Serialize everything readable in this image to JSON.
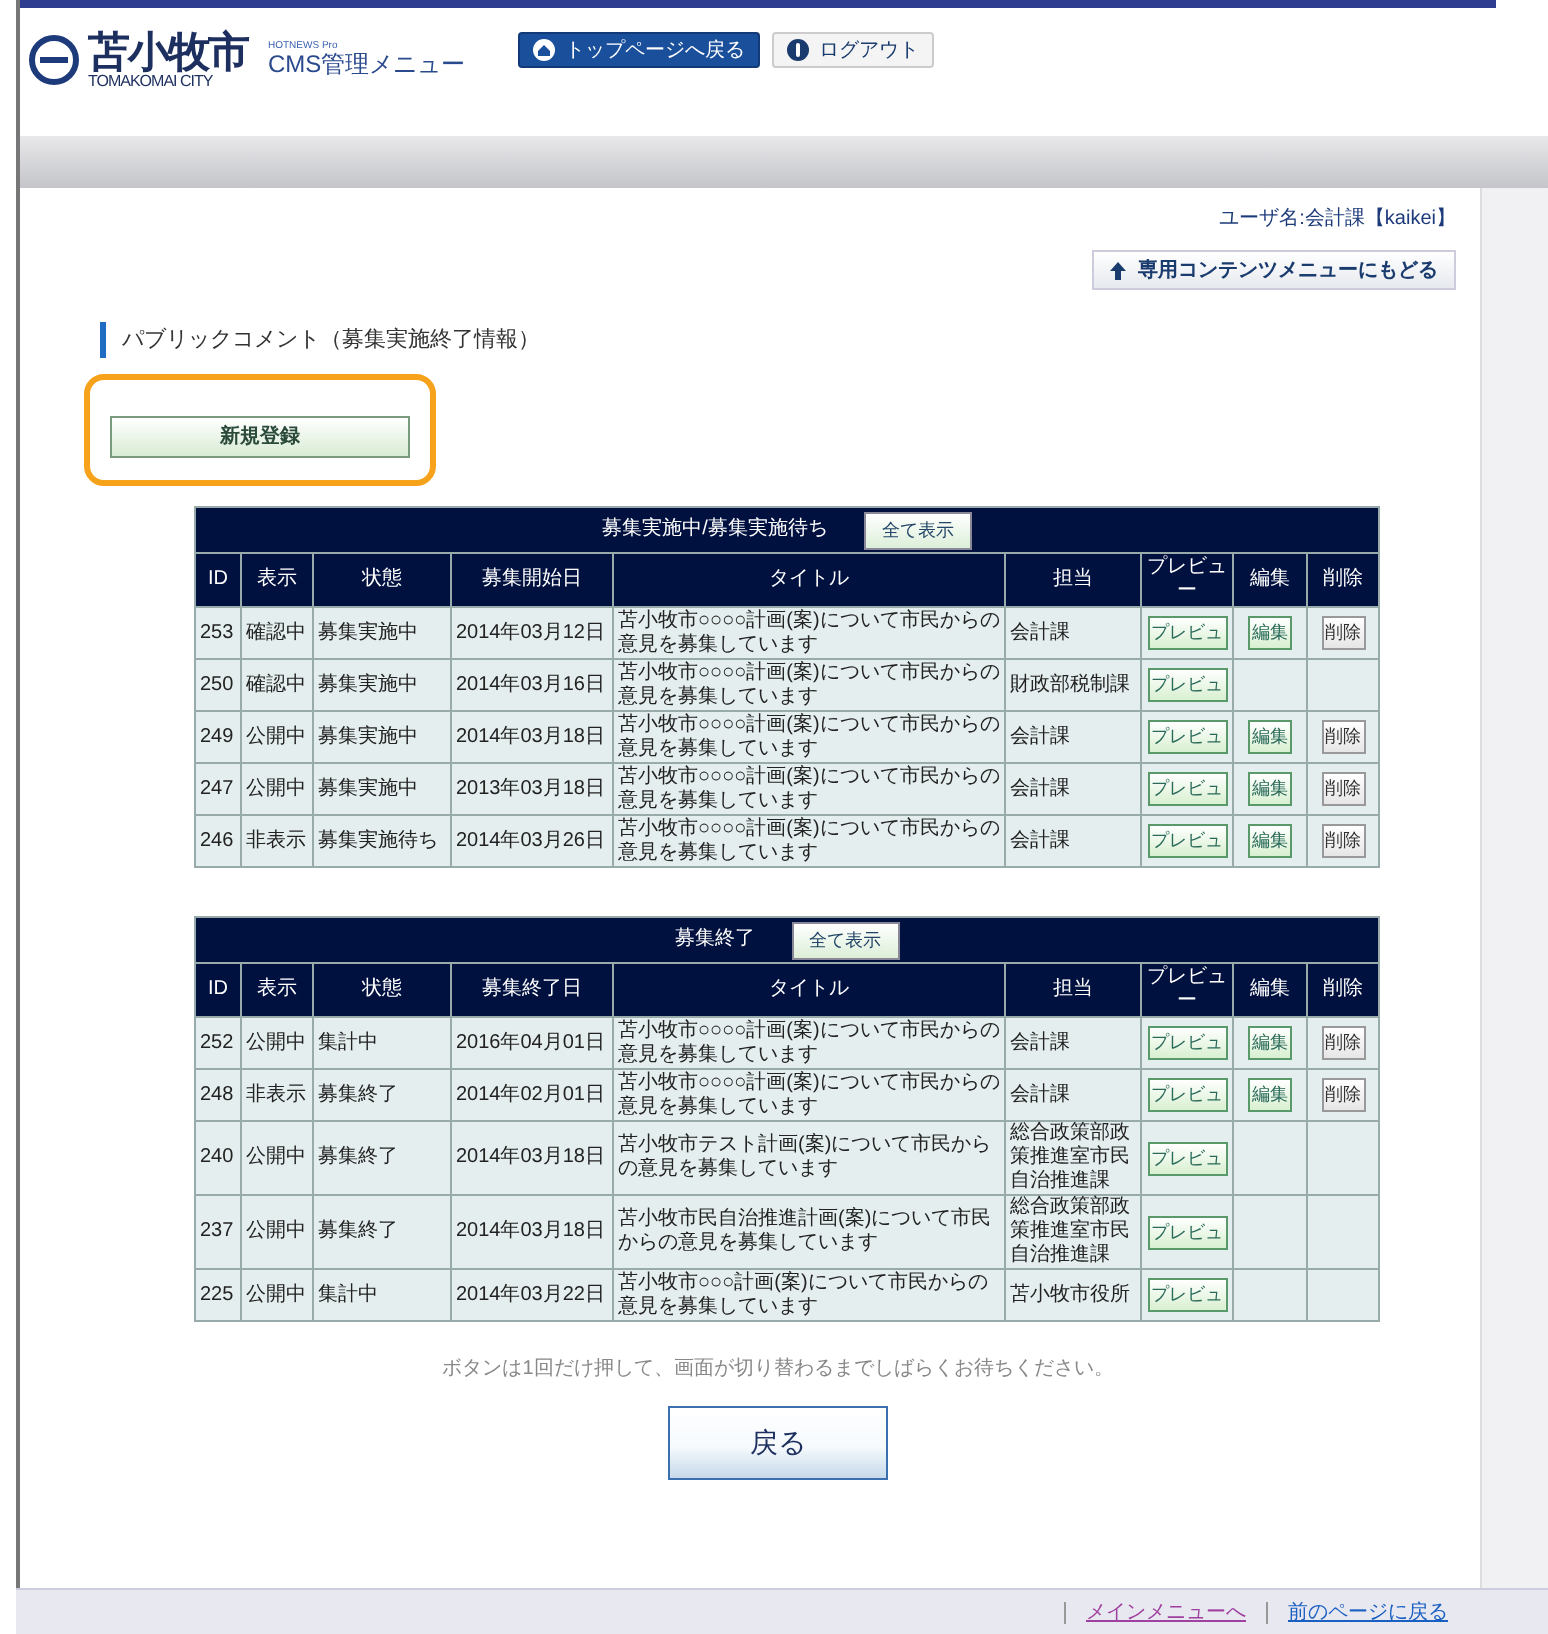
{
  "header": {
    "logo_text": "苫小牧市",
    "logo_sub": "TOMAKOMAI CITY",
    "product": "HOTNEWS Pro",
    "app_title": "CMS管理メニュー",
    "buttons": [
      {
        "label": "トップページへ戻る",
        "kind": "primary"
      },
      {
        "label": "ログアウト",
        "kind": "plain"
      }
    ]
  },
  "user": "ユーザ名:会計課【kaikei】",
  "content_menu_button": "専用コンテンツメニューにもどる",
  "heading": "パブリックコメント（募集実施終了情報）",
  "new_button": "新規登録",
  "tables": [
    {
      "title": "募集実施中/募集実施待ち",
      "show_all": "全て表示",
      "columns": [
        "ID",
        "表示",
        "状態",
        "募集開始日",
        "タイトル",
        "担当",
        "プレビュー",
        "編集",
        "削除"
      ],
      "rows": [
        {
          "id": "253",
          "display": "確認中",
          "status": "募集実施中",
          "date": "2014年03月12日",
          "title": "苫小牧市○○○○計画(案)について市民からの意見を募集しています",
          "owner": "会計課",
          "preview": "プレビュ",
          "edit": "編集",
          "delete": "削除"
        },
        {
          "id": "250",
          "display": "確認中",
          "status": "募集実施中",
          "date": "2014年03月16日",
          "title": "苫小牧市○○○○計画(案)について市民からの意見を募集しています",
          "owner": "財政部税制課",
          "preview": "プレビュ"
        },
        {
          "id": "249",
          "display": "公開中",
          "status": "募集実施中",
          "date": "2014年03月18日",
          "title": "苫小牧市○○○○計画(案)について市民からの意見を募集しています",
          "owner": "会計課",
          "preview": "プレビュ",
          "edit": "編集",
          "delete": "削除"
        },
        {
          "id": "247",
          "display": "公開中",
          "status": "募集実施中",
          "date": "2013年03月18日",
          "title": "苫小牧市○○○○計画(案)について市民からの意見を募集しています",
          "owner": "会計課",
          "preview": "プレビュ",
          "edit": "編集",
          "delete": "削除"
        },
        {
          "id": "246",
          "display": "非表示",
          "status": "募集実施待ち",
          "date": "2014年03月26日",
          "title": "苫小牧市○○○○計画(案)について市民からの意見を募集しています",
          "owner": "会計課",
          "preview": "プレビュ",
          "edit": "編集",
          "delete": "削除"
        }
      ]
    },
    {
      "title": "募集終了",
      "show_all": "全て表示",
      "columns": [
        "ID",
        "表示",
        "状態",
        "募集終了日",
        "タイトル",
        "担当",
        "プレビュー",
        "編集",
        "削除"
      ],
      "rows": [
        {
          "id": "252",
          "display": "公開中",
          "status": "集計中",
          "date": "2016年04月01日",
          "title": "苫小牧市○○○○計画(案)について市民からの意見を募集しています",
          "owner": "会計課",
          "preview": "プレビュ",
          "edit": "編集",
          "delete": "削除"
        },
        {
          "id": "248",
          "display": "非表示",
          "status": "募集終了",
          "date": "2014年02月01日",
          "title": "苫小牧市○○○○計画(案)について市民からの意見を募集しています",
          "owner": "会計課",
          "preview": "プレビュ",
          "edit": "編集",
          "delete": "削除"
        },
        {
          "id": "240",
          "display": "公開中",
          "status": "募集終了",
          "date": "2014年03月18日",
          "title": "苫小牧市テスト計画(案)について市民からの意見を募集しています",
          "owner": "総合政策部政策推進室市民自治推進課",
          "preview": "プレビュ"
        },
        {
          "id": "237",
          "display": "公開中",
          "status": "募集終了",
          "date": "2014年03月18日",
          "title": "苫小牧市民自治推進計画(案)について市民からの意見を募集しています",
          "owner": "総合政策部政策推進室市民自治推進課",
          "preview": "プレビュ"
        },
        {
          "id": "225",
          "display": "公開中",
          "status": "集計中",
          "date": "2014年03月22日",
          "title": "苫小牧市○○○計画(案)について市民からの意見を募集しています",
          "owner": "苫小牧市役所",
          "preview": "プレビュ"
        }
      ]
    }
  ],
  "note": "ボタンは1回だけ押して、画面が切り替わるまでしばらくお待ちください。",
  "back_button": "戻る",
  "footer_links": [
    {
      "label": "メインメニューへ",
      "visited": true
    },
    {
      "label": "前のページに戻る",
      "visited": false
    }
  ]
}
